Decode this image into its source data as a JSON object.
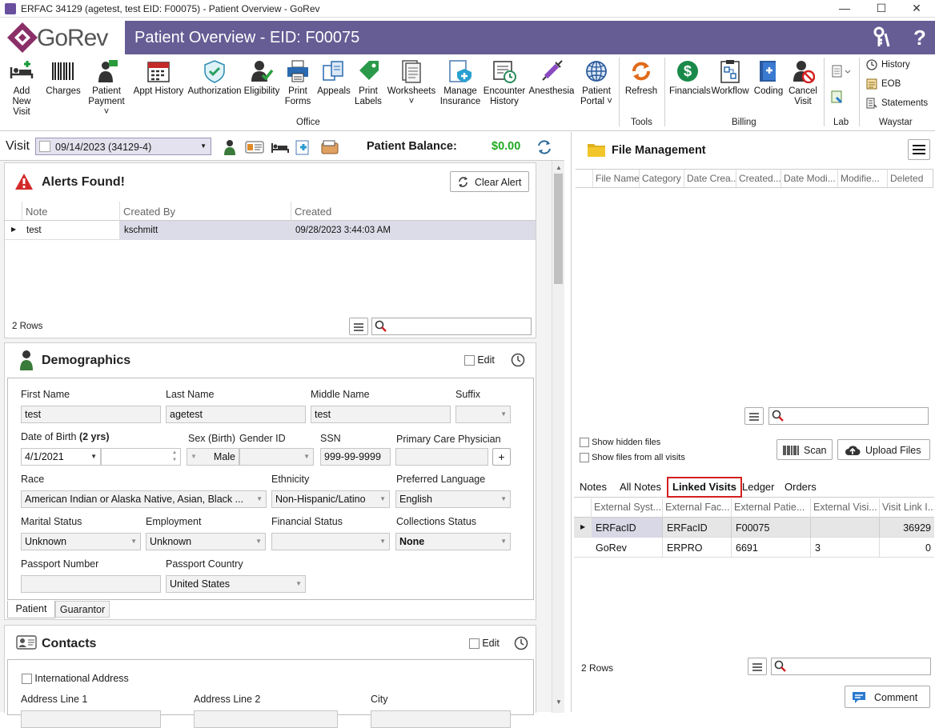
{
  "window": {
    "title": "ERFAC 34129 (agetest, test EID: F00075) - Patient Overview - GoRev",
    "minimize": "—",
    "maximize": "☐",
    "close": "✕"
  },
  "header": {
    "logo_text": "GoRev",
    "page_title": "Patient Overview - EID: F00075",
    "help": "?"
  },
  "ribbon": {
    "office": [
      {
        "label1": "Add New",
        "label2": "Visit",
        "icon": "add-visit-icon"
      },
      {
        "label1": "Charges",
        "label2": "",
        "icon": "barcode-icon"
      },
      {
        "label1": "Patient",
        "label2": "Payment ˅",
        "icon": "payment-icon"
      },
      {
        "label1": "Appt History",
        "label2": "",
        "icon": "calendar-icon"
      },
      {
        "label1": "Authorization",
        "label2": "",
        "icon": "shield-check-icon"
      },
      {
        "label1": "Eligibility",
        "label2": "",
        "icon": "person-check-icon"
      },
      {
        "label1": "Print",
        "label2": "Forms",
        "icon": "printer-icon"
      },
      {
        "label1": "Appeals",
        "label2": "",
        "icon": "appeals-icon"
      },
      {
        "label1": "Print",
        "label2": "Labels",
        "icon": "label-icon"
      },
      {
        "label1": "Worksheets",
        "label2": "˅",
        "icon": "worksheets-icon"
      },
      {
        "label1": "Manage",
        "label2": "Insurance",
        "icon": "insurance-icon"
      },
      {
        "label1": "Encounter",
        "label2": "History",
        "icon": "encounter-icon"
      },
      {
        "label1": "Anesthesia",
        "label2": "",
        "icon": "syringe-icon"
      },
      {
        "label1": "Patient",
        "label2": "Portal ˅",
        "icon": "globe-icon"
      }
    ],
    "office_group": "Office",
    "tools": {
      "label1": "Refresh",
      "label2": "",
      "icon": "refresh-icon"
    },
    "tools_group": "Tools",
    "billing": [
      {
        "label1": "Financials",
        "label2": "",
        "icon": "dollar-icon"
      },
      {
        "label1": "Workflow",
        "label2": "",
        "icon": "workflow-icon"
      },
      {
        "label1": "Coding",
        "label2": "",
        "icon": "coding-icon"
      },
      {
        "label1": "Cancel",
        "label2": "Visit",
        "icon": "cancel-visit-icon"
      }
    ],
    "billing_group": "Billing",
    "lab_group": "Lab",
    "waystar": [
      "History",
      "EOB",
      "Statements"
    ],
    "waystar_group": "Waystar"
  },
  "visitbar": {
    "label": "Visit",
    "visit_value": "09/14/2023 (34129-4)",
    "balance_label": "Patient Balance:",
    "balance_value": "$0.00"
  },
  "alerts": {
    "title": "Alerts Found!",
    "clear_button": "Clear Alert",
    "columns": [
      "Note",
      "Created By",
      "Created"
    ],
    "rows": [
      {
        "note": "test",
        "created_by": "kschmitt",
        "created": "09/28/2023 3:44:03 AM"
      }
    ],
    "footer": "2 Rows"
  },
  "demographics": {
    "title": "Demographics",
    "edit": "Edit",
    "first_name_label": "First Name",
    "first_name": "test",
    "last_name_label": "Last Name",
    "last_name": "agetest",
    "middle_name_label": "Middle Name",
    "middle_name": "test",
    "suffix_label": "Suffix",
    "suffix": "",
    "dob_label": "Date of Birth",
    "dob_age": "(2 yrs)",
    "dob": "4/1/2021",
    "sex_label": "Sex (Birth)",
    "sex": "Male",
    "gender_label": "Gender ID",
    "gender": "",
    "ssn_label": "SSN",
    "ssn": "999-99-9999",
    "pcp_label": "Primary Care Physician",
    "pcp": "",
    "pcp_add": "+",
    "race_label": "Race",
    "race": "American Indian or Alaska Native, Asian, Black ...",
    "ethnicity_label": "Ethnicity",
    "ethnicity": "Non-Hispanic/Latino",
    "language_label": "Preferred Language",
    "language": "English",
    "marital_label": "Marital Status",
    "marital": "Unknown",
    "employment_label": "Employment",
    "employment": "Unknown",
    "financial_label": "Financial Status",
    "financial": "",
    "collections_label": "Collections Status",
    "collections": "None",
    "passport_label": "Passport Number",
    "passport": "",
    "passport_country_label": "Passport Country",
    "passport_country": "United States",
    "tabs": [
      "Patient",
      "Guarantor"
    ]
  },
  "contacts": {
    "title": "Contacts",
    "edit": "Edit",
    "intl_address": "International Address",
    "address1_label": "Address Line 1",
    "address2_label": "Address Line 2",
    "city_label": "City"
  },
  "file_management": {
    "title": "File Management",
    "columns": [
      "File Name",
      "Category",
      "Date Crea...",
      "Created...",
      "Date Modi...",
      "Modifie...",
      "Deleted"
    ],
    "show_hidden": "Show hidden files",
    "show_all_visits": "Show files from all visits",
    "scan": "Scan",
    "upload": "Upload Files"
  },
  "linked": {
    "tabs": [
      "Notes",
      "All Notes",
      "Linked Visits",
      "Ledger",
      "Orders"
    ],
    "columns": [
      "External Syst...",
      "External Fac...",
      "External Patie...",
      "External Visi...",
      "Visit Link I..."
    ],
    "rows": [
      {
        "system": "ERFacID",
        "facility": "ERFacID",
        "patient": "F00075",
        "visit": "",
        "link": "36929"
      },
      {
        "system": "GoRev",
        "facility": "ERPRO",
        "patient": "6691",
        "visit": "3",
        "link": "0"
      }
    ],
    "footer": "2 Rows",
    "comment": "Comment"
  },
  "colors": {
    "header": "#655d94",
    "accent": "#8a2f67",
    "balance": "#22aa22",
    "highlight_border": "#d42020"
  }
}
